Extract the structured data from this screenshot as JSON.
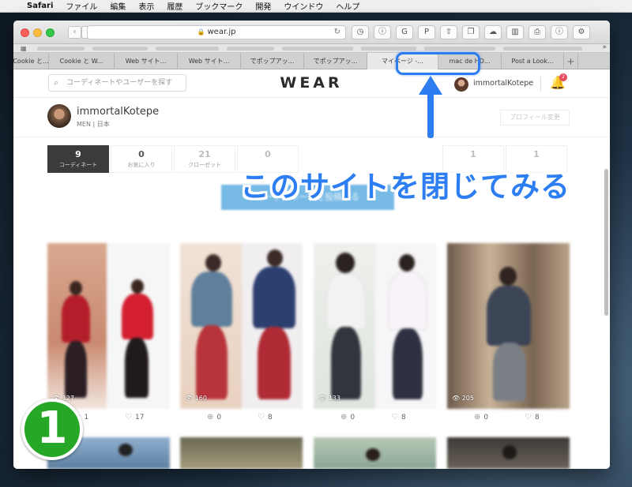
{
  "menubar": {
    "items": [
      "Safari",
      "ファイル",
      "編集",
      "表示",
      "履歴",
      "ブックマーク",
      "開発",
      "ウインドウ",
      "ヘルプ"
    ]
  },
  "browser": {
    "url": "wear.jp",
    "tabs": [
      {
        "label": "Cookie と..."
      },
      {
        "label": "Cookie と W..."
      },
      {
        "label": "Web サイト..."
      },
      {
        "label": "Web サイト..."
      },
      {
        "label": "でポップアッ..."
      },
      {
        "label": "でポップアッ..."
      },
      {
        "label": "マイページ -...",
        "active": true
      },
      {
        "label": "mac de HD..."
      },
      {
        "label": "Post a Look..."
      }
    ]
  },
  "site": {
    "logo": "WEAR",
    "search_placeholder": "コーディネートやユーザーを探す",
    "username": "immortalKotepe",
    "notification_count": "2"
  },
  "profile": {
    "name": "immortalKotepe",
    "gender": "MEN",
    "country": "日本",
    "edit_label": "プロフィール変更"
  },
  "stats": [
    {
      "num": "9",
      "label": "コーディネート",
      "active": true
    },
    {
      "num": "0",
      "label": "お気に入り"
    },
    {
      "num": "21",
      "label": "クローゼット"
    },
    {
      "num": "0",
      "label": ""
    },
    {
      "num": "1",
      "label": ""
    },
    {
      "num": "1",
      "label": ""
    }
  ],
  "post_button": "コーディネートを投稿する",
  "cards": [
    {
      "views": "127",
      "saves": "1",
      "likes": "17"
    },
    {
      "views": "160",
      "saves": "0",
      "likes": "8"
    },
    {
      "views": "133",
      "saves": "0",
      "likes": "8"
    },
    {
      "views": "205",
      "saves": "0",
      "likes": "8"
    }
  ],
  "annotation": {
    "text": "このサイトを閉じてみる",
    "step": "1",
    "accent": "#2e7df0"
  }
}
